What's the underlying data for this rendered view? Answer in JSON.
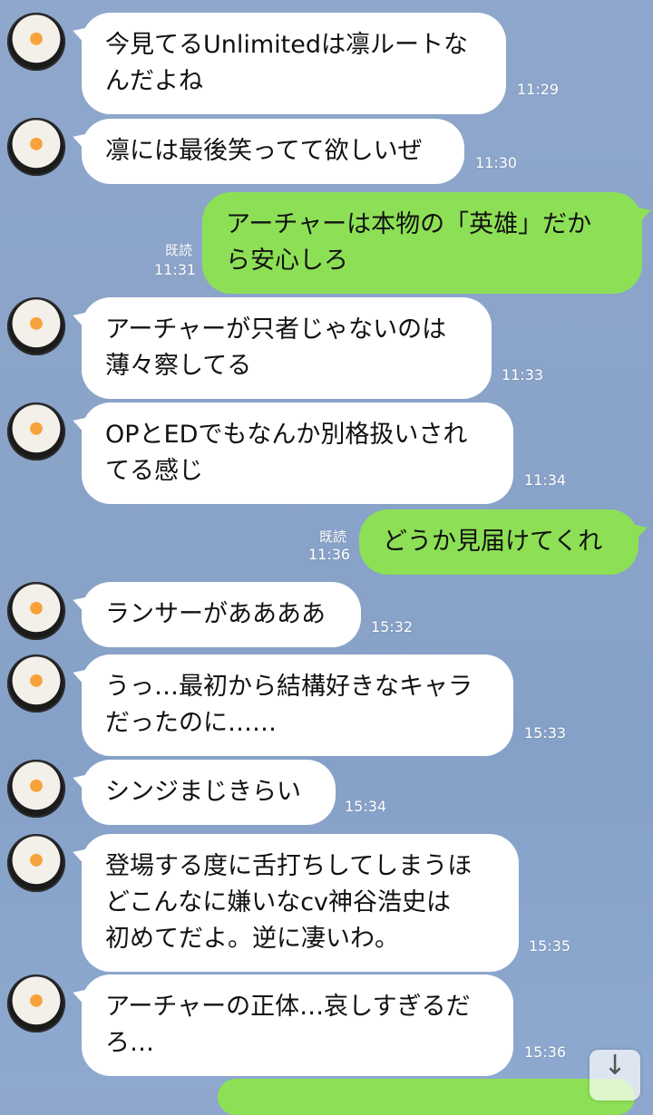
{
  "app": {
    "name": "LINE chat"
  },
  "messages": [
    {
      "side": "in",
      "text": "今見てるUnlimitedは凛ルートな\nんだよね",
      "time": "11:29"
    },
    {
      "side": "in",
      "text": "凛には最後笑ってて欲しいぜ",
      "time": "11:30"
    },
    {
      "side": "out",
      "text": "アーチャーは本物の「英雄」だか\nら安心しろ",
      "time": "11:31",
      "read": "既読"
    },
    {
      "side": "in",
      "text": "アーチャーが只者じゃないのは\n薄々察してる",
      "time": "11:33"
    },
    {
      "side": "in",
      "text": "OPとEDでもなんか別格扱いされ\nてる感じ",
      "time": "11:34"
    },
    {
      "side": "out",
      "text": "どうか見届けてくれ",
      "time": "11:36",
      "read": "既読"
    },
    {
      "side": "in",
      "text": "ランサーがああああ",
      "time": "15:32"
    },
    {
      "side": "in",
      "text": "うっ…最初から結構好きなキャラ\nだったのに……",
      "time": "15:33"
    },
    {
      "side": "in",
      "text": "シンジまじきらい",
      "time": "15:34"
    },
    {
      "side": "in",
      "text": "登場する度に舌打ちしてしまうほ\nどこんなに嫌いなcv神谷浩史は\n初めてだよ。逆に凄いわ。",
      "time": "15:35"
    },
    {
      "side": "in",
      "text": "アーチャーの正体…哀しすぎるだ\nろ…",
      "time": "15:36"
    }
  ],
  "controls": {
    "scroll_down_icon": "arrow-down-icon",
    "scroll_down_glyph": "↓"
  },
  "colors": {
    "incoming_bubble": "#ffffff",
    "outgoing_bubble": "#8de055",
    "background": "#8aa3c9"
  }
}
